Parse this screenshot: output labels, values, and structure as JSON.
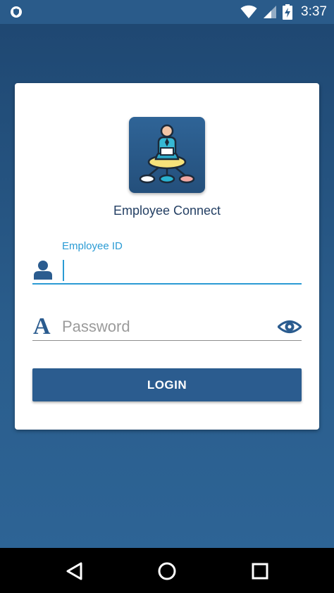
{
  "status_bar": {
    "time": "3:37",
    "icons": [
      "vpn-shield-icon",
      "wifi-icon",
      "signal-icon",
      "battery-charging-icon"
    ]
  },
  "app": {
    "title": "Employee Connect",
    "logo_icon": "org-chart-person-icon"
  },
  "form": {
    "employee_id": {
      "label": "Employee ID",
      "value": "",
      "icon": "user-icon"
    },
    "password": {
      "placeholder": "Password",
      "value": "",
      "icon": "password-letter-icon",
      "toggle_icon": "eye-icon"
    },
    "login_label": "LOGIN"
  },
  "nav_bar": {
    "buttons": [
      "back-icon",
      "home-icon",
      "recents-icon"
    ]
  },
  "colors": {
    "primary": "#2b5c8f",
    "accent": "#2a9bd4",
    "background": "#245382"
  }
}
